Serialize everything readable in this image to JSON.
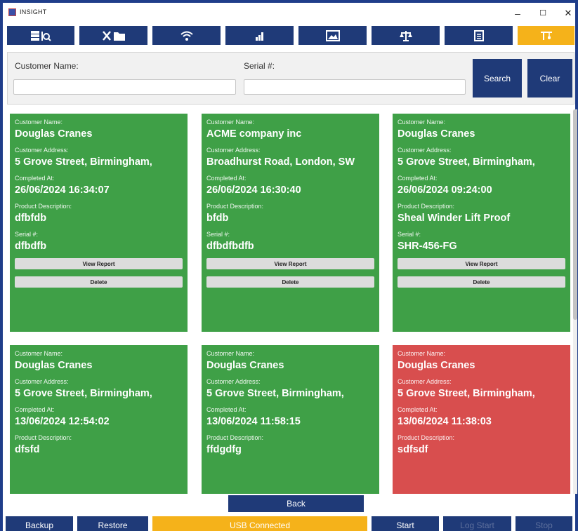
{
  "window": {
    "title": "INSIGHT",
    "minimize": "–",
    "maximize": "☐",
    "close": "✕"
  },
  "toolbar": {
    "buttons": [
      {
        "icon": "database-search-icon"
      },
      {
        "icon": "tools-folder-icon"
      },
      {
        "icon": "wifi-icon"
      },
      {
        "icon": "bar-chart-icon"
      },
      {
        "icon": "image-icon"
      },
      {
        "icon": "scale-icon"
      },
      {
        "icon": "document-icon"
      },
      {
        "icon": "crane-hook-icon",
        "active": true
      }
    ],
    "active_color": "#f5b21a",
    "color": "#1f3a78"
  },
  "search": {
    "customer_label": "Customer Name:",
    "customer_value": "",
    "serial_label": "Serial #:",
    "serial_value": "",
    "search_label": "Search",
    "clear_label": "Clear"
  },
  "card_labels": {
    "customer": "Customer Name:",
    "address": "Customer Address:",
    "completed": "Completed At:",
    "product": "Product Description:",
    "serial": "Serial #:",
    "view": "View Report",
    "delete": "Delete"
  },
  "records": [
    {
      "status": "green",
      "customer": "Douglas Cranes",
      "address": "5 Grove Street, Birmingham,",
      "completed": "26/06/2024 16:34:07",
      "product": "dfbfdb",
      "serial": "dfbdfb"
    },
    {
      "status": "green",
      "customer": "ACME company inc",
      "address": "Broadhurst Road, London, SW",
      "completed": "26/06/2024 16:30:40",
      "product": "bfdb",
      "serial": "dfbdfbdfb"
    },
    {
      "status": "green",
      "customer": "Douglas Cranes",
      "address": "5 Grove Street, Birmingham,",
      "completed": "26/06/2024 09:24:00",
      "product": "Sheal Winder Lift Proof",
      "serial": "SHR-456-FG"
    },
    {
      "status": "green",
      "customer": "Douglas Cranes",
      "address": "5 Grove Street, Birmingham,",
      "completed": "13/06/2024 12:54:02",
      "product": "dfsfd",
      "serial": ""
    },
    {
      "status": "green",
      "customer": "Douglas Cranes",
      "address": "5 Grove Street, Birmingham,",
      "completed": "13/06/2024 11:58:15",
      "product": "ffdgdfg",
      "serial": ""
    },
    {
      "status": "red",
      "customer": "Douglas Cranes",
      "address": "5 Grove Street, Birmingham,",
      "completed": "13/06/2024 11:38:03",
      "product": "sdfsdf",
      "serial": ""
    }
  ],
  "status_colors": {
    "green": "#3fa047",
    "red": "#d84e4e"
  },
  "back_label": "Back",
  "bottom": {
    "backup": "Backup",
    "restore": "Restore",
    "usb": "USB Connected",
    "start": "Start",
    "log_start": "Log Start",
    "stop": "Stop"
  }
}
